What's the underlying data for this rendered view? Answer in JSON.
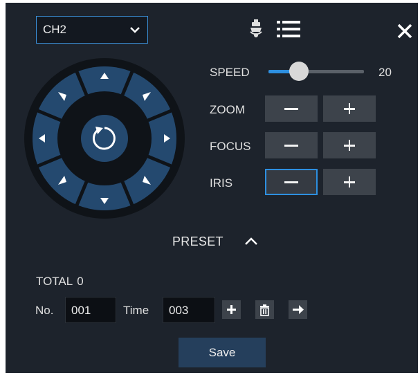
{
  "channel": {
    "selected": "CH2"
  },
  "controls": {
    "speed": {
      "label": "SPEED",
      "value": "20",
      "level_fraction": 0.32
    },
    "zoom": {
      "label": "ZOOM"
    },
    "focus": {
      "label": "FOCUS"
    },
    "iris": {
      "label": "IRIS"
    }
  },
  "preset": {
    "toggle_label": "PRESET",
    "total_label": "TOTAL",
    "total_value": "0",
    "no_label": "No.",
    "no_value": "001",
    "time_label": "Time",
    "time_value": "003"
  },
  "save_label": "Save",
  "colors": {
    "panel_bg": "#1d232c",
    "wheel_ring": "#24496f",
    "accent": "#2d8fe0",
    "button_bg": "#3d434b",
    "save_bg": "#253f5c"
  },
  "icons": [
    "chevron-down-icon",
    "ptz-camera-icon",
    "list-icon",
    "close-icon",
    "refresh-icon",
    "arrow-up-icon",
    "arrow-down-icon",
    "arrow-left-icon",
    "arrow-right-icon",
    "arrow-up-left-icon",
    "arrow-up-right-icon",
    "arrow-down-left-icon",
    "arrow-down-right-icon",
    "minus-icon",
    "plus-icon",
    "chevron-up-icon",
    "trash-icon",
    "arrow-right-icon"
  ]
}
